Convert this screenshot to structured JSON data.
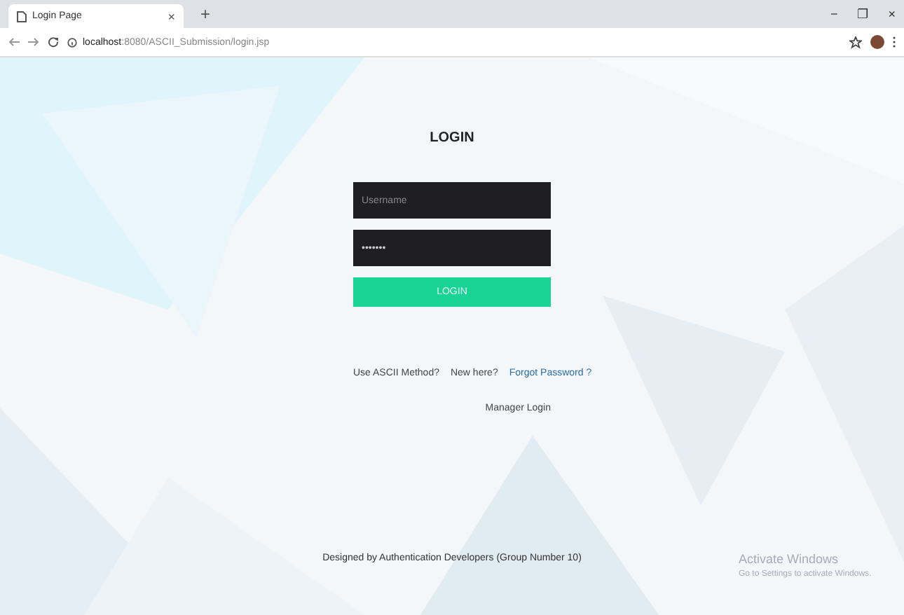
{
  "browser": {
    "tab_title": "Login Page",
    "tab_close": "×",
    "new_tab": "+",
    "address": "localhost:8080/ASCII_Submission/login.jsp",
    "window_controls": [
      "−",
      "❐",
      "×"
    ]
  },
  "login": {
    "title": "LOGIN",
    "username": {
      "placeholder": "Username"
    },
    "password": {
      "value": "•••••••"
    },
    "submit": "LOGIN",
    "links": [
      {
        "text": "Use ASCII Method?",
        "kind": "link"
      },
      {
        "text": "New here?",
        "kind": "plain"
      },
      {
        "text": "Forgot Password ?",
        "kind": "accent"
      }
    ],
    "manager_link": "Manager Login"
  },
  "footer": "Designed by Authentication Developers (Group Number 10)",
  "os_notice": {
    "title": "Activate Windows",
    "subtitle": "Go to Settings to activate Windows."
  }
}
